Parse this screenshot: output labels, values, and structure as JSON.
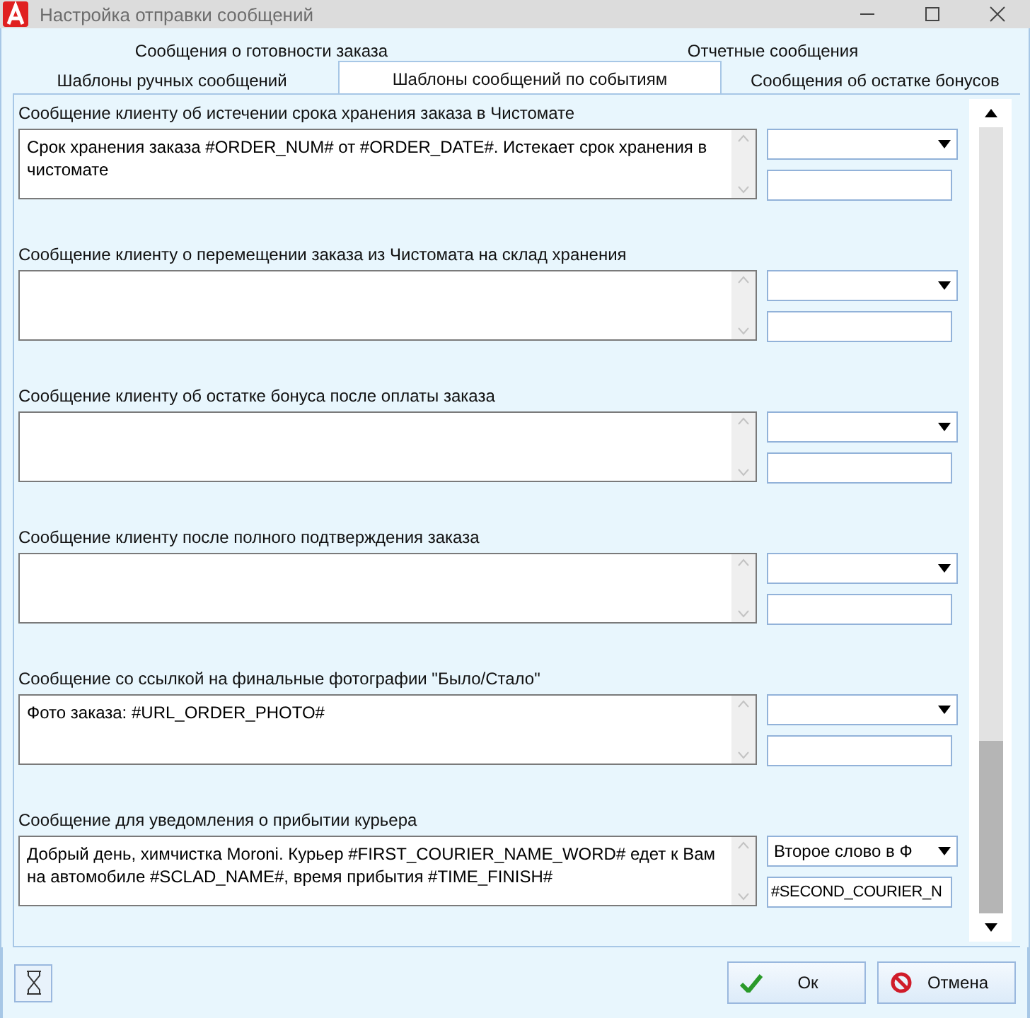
{
  "window": {
    "title": "Настройка отправки сообщений"
  },
  "tab_rows": [
    [
      {
        "label": "Сообщения о готовности заказа",
        "selected": false
      },
      {
        "label": "Отчетные сообщения",
        "selected": false
      }
    ],
    [
      {
        "label": "Шаблоны ручных сообщений",
        "selected": false
      },
      {
        "label": "Шаблоны сообщений по событиям",
        "selected": true
      },
      {
        "label": "Сообщения об остатке бонусов",
        "selected": false
      }
    ]
  ],
  "sections": [
    {
      "label": "Сообщение клиенту об истечении срока хранения заказа в Чистомате",
      "text": "Срок хранения заказа #ORDER_NUM# от #ORDER_DATE#. Истекает срок хранения в чистомате"
    },
    {
      "label": "Сообщение клиенту о перемещении заказа из Чистомата на склад хранения"
    },
    {
      "label": "Сообщение клиенту об остатке бонуса после оплаты заказа"
    },
    {
      "label": "Сообщение клиенту после полного подтверждения заказа"
    },
    {
      "label": "Сообщение со ссылкой на финальные фотографии \"Было/Стало\"",
      "text": "Фото заказа: #URL_ORDER_PHOTO#"
    },
    {
      "label": "Сообщение для уведомления о прибытии курьера",
      "text": "Добрый день, химчистка Moroni. Курьер #FIRST_COURIER_NAME_WORD# едет к Вам на автомобиле #SCLAD_NAME#, время прибытия #TIME_FINISH#",
      "combo": "Второе слово в Ф",
      "field": "#SECOND_COURIER_N"
    }
  ],
  "buttons": [
    {
      "kind": "ok",
      "label": "Ок"
    },
    {
      "kind": "cancel",
      "label": "Отмена"
    }
  ]
}
